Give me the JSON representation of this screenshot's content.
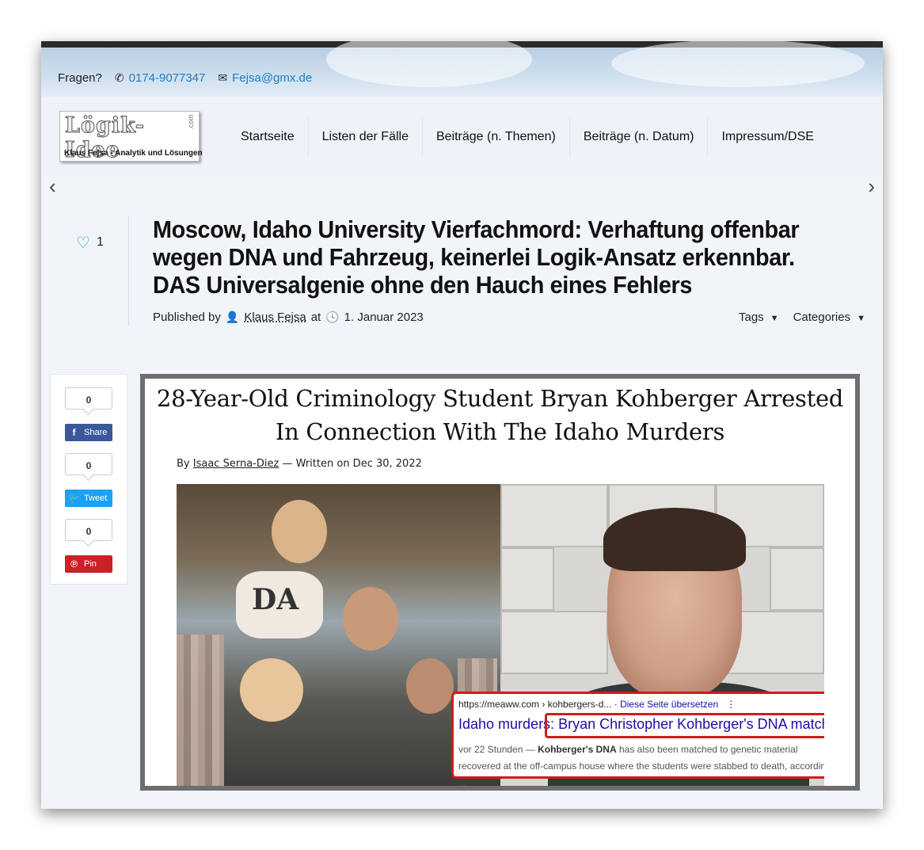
{
  "header": {
    "question_label": "Fragen?",
    "phone": "0174-9077347",
    "email": "Fejsa@gmx.de"
  },
  "logo": {
    "title": "Lögik-Idee",
    "tld": ".com",
    "subtitle": "Klaus Fejsa  -  Analytik und Lösungen"
  },
  "nav": {
    "items": [
      {
        "label": "Startseite"
      },
      {
        "label": "Listen der Fälle"
      },
      {
        "label": "Beiträge (n. Themen)"
      },
      {
        "label": "Beiträge (n. Datum)"
      },
      {
        "label": "Impressum/DSE"
      }
    ],
    "prev_arrow": "‹",
    "next_arrow": "›"
  },
  "post": {
    "like_count": "1",
    "title": "Moscow, Idaho University Vierfachmord: Verhaftung offenbar wegen DNA und Fahrzeug, keinerlei Logik-Ansatz erkennbar. DAS Universalgenie ohne den Hauch eines Fehlers",
    "published_by": "Published by",
    "author": "Klaus Fejsa",
    "at": "at",
    "date": "1. Januar 2023",
    "tags_label": "Tags",
    "categories_label": "Categories"
  },
  "social": {
    "share_count": "0",
    "share_label": "Share",
    "tweet_count": "0",
    "tweet_label": "Tweet",
    "pin_count": "0",
    "pin_label": "Pin"
  },
  "article": {
    "headline_line1": "28-Year-Old Criminology Student Bryan Kohberger Arrested",
    "headline_line2": "In Connection With The Idaho Murders",
    "by": "By",
    "byline_author": "Isaac Serna-Diez",
    "byline_rest": "— Written on Dec 30, 2022",
    "sweatshirt_text": "DA"
  },
  "search_snippet": {
    "url": "https://meaww.com › kohbergers-d...",
    "translate": "Diese Seite übersetzen",
    "title_prefix": "Idaho murders:",
    "title_highlight": "Bryan Christopher Kohberger's DNA matched ...",
    "text_age": "vor 22 Stunden —",
    "text_bold": "Kohberger's DNA",
    "text_rest": "has also been matched to genetic material recovered at the off-campus house where the students were stabbed to death, according ..."
  },
  "colors": {
    "link": "#1f7bc0",
    "facebook": "#3b5998",
    "twitter": "#1da1f2",
    "pinterest": "#cb2027",
    "highlight_border": "#d01c1c"
  }
}
